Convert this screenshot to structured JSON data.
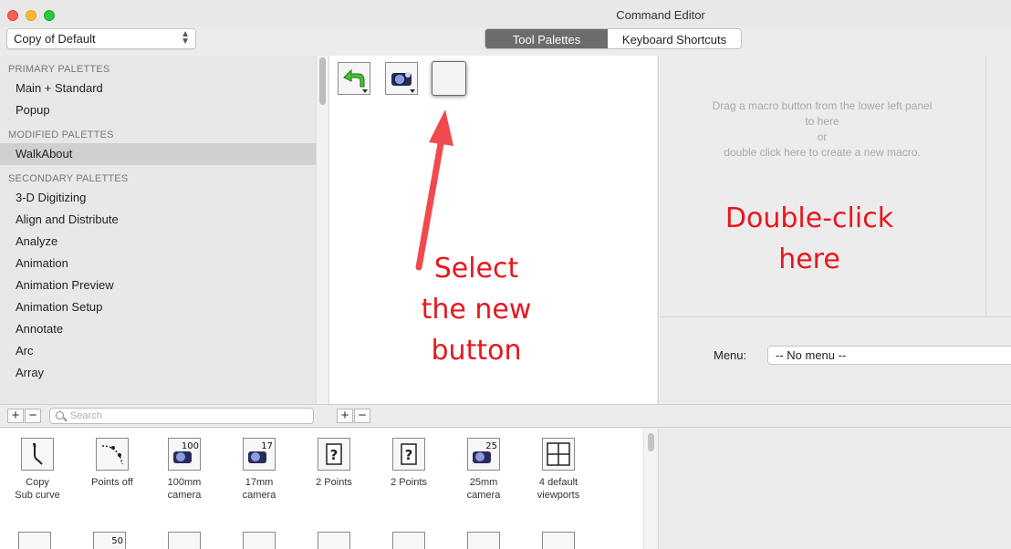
{
  "window": {
    "title": "Command Editor",
    "traffic_colors": [
      "#fe5f57",
      "#febc2e",
      "#28c840"
    ]
  },
  "workspace_select": {
    "value": "Copy of Default"
  },
  "tabs": [
    {
      "label": "Tool Palettes",
      "active": true
    },
    {
      "label": "Keyboard Shortcuts",
      "active": false
    }
  ],
  "palettes": {
    "primary_header": "PRIMARY PALETTES",
    "primary": [
      "Main + Standard",
      "Popup"
    ],
    "modified_header": "MODIFIED PALETTES",
    "modified": [
      "WalkAbout"
    ],
    "secondary_header": "SECONDARY PALETTES",
    "secondary": [
      "3-D Digitizing",
      "Align and Distribute",
      "Analyze",
      "Animation",
      "Animation Preview",
      "Animation Setup",
      "Annotate",
      "Arc",
      "Array"
    ]
  },
  "right_panel": {
    "hint_line1": "Drag a macro button from the lower left panel",
    "hint_line2": "to here",
    "hint_line3": "or",
    "hint_line4": "double click here to create a new macro.",
    "menu_label": "Menu:",
    "menu_value": "-- No menu --"
  },
  "search": {
    "placeholder": "Search"
  },
  "bars": {
    "plus": "+",
    "minus": "−"
  },
  "macros": [
    {
      "line1": "Copy",
      "line2": "Sub curve",
      "icon": "copy-sub-curve-icon"
    },
    {
      "line1": "Points off",
      "line2": "",
      "icon": "points-off-icon"
    },
    {
      "line1": "100mm",
      "line2": "camera",
      "icon": "camera-icon",
      "badge": "100"
    },
    {
      "line1": "17mm",
      "line2": "camera",
      "icon": "camera-icon",
      "badge": "17"
    },
    {
      "line1": "2 Points",
      "line2": "",
      "icon": "question-icon"
    },
    {
      "line1": "2 Points",
      "line2": "",
      "icon": "question-icon"
    },
    {
      "line1": "25mm",
      "line2": "camera",
      "icon": "camera-icon",
      "badge": "25"
    },
    {
      "line1": "4 default",
      "line2": "viewports",
      "icon": "viewports-icon"
    }
  ],
  "macros_row2_badge": "50",
  "annotations": {
    "select_line1": "Select",
    "select_line2": "the new",
    "select_line3": "button",
    "dbl_line1": "Double-click",
    "dbl_line2": "here",
    "color": "#e8161e"
  }
}
